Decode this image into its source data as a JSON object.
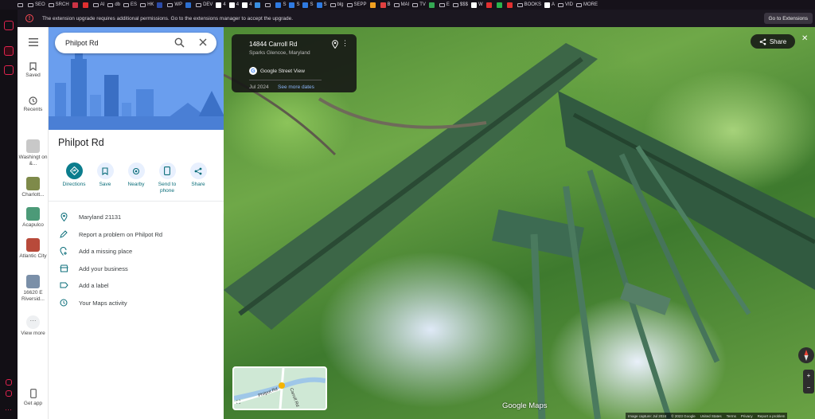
{
  "browser": {
    "bookmarks": [
      {
        "label": "",
        "kind": "folder"
      },
      {
        "label": "SEO",
        "kind": "folder"
      },
      {
        "label": "SRCH",
        "kind": "folder"
      },
      {
        "label": "",
        "kind": "sq",
        "color": "#cc3344"
      },
      {
        "label": "",
        "kind": "sq",
        "color": "#e03030"
      },
      {
        "label": "AI",
        "kind": "folder"
      },
      {
        "label": "db",
        "kind": "folder"
      },
      {
        "label": "ES",
        "kind": "folder"
      },
      {
        "label": "HK",
        "kind": "folder"
      },
      {
        "label": "",
        "kind": "sq",
        "color": "#2b4ba8"
      },
      {
        "label": "WP",
        "kind": "folder"
      },
      {
        "label": "",
        "kind": "sq",
        "color": "#2d6fd0"
      },
      {
        "label": "DEV",
        "kind": "folder"
      },
      {
        "label": "4",
        "kind": "sq",
        "color": "#ffffff"
      },
      {
        "label": "4",
        "kind": "sq",
        "color": "#ffffff"
      },
      {
        "label": "4",
        "kind": "sq",
        "color": "#ffffff"
      },
      {
        "label": "",
        "kind": "sq",
        "color": "#3a8fe0"
      },
      {
        "label": "",
        "kind": "folder"
      },
      {
        "label": "S",
        "kind": "sq",
        "color": "#2f7ae0"
      },
      {
        "label": "S",
        "kind": "sq",
        "color": "#2f7ae0"
      },
      {
        "label": "S",
        "kind": "sq",
        "color": "#2f7ae0"
      },
      {
        "label": "S",
        "kind": "sq",
        "color": "#2f7ae0"
      },
      {
        "label": "blg",
        "kind": "folder"
      },
      {
        "label": "SEPP",
        "kind": "folder"
      },
      {
        "label": "",
        "kind": "sq",
        "color": "#f0a020"
      },
      {
        "label": "B",
        "kind": "sq",
        "color": "#e04040"
      },
      {
        "label": "MAI",
        "kind": "folder"
      },
      {
        "label": "TV",
        "kind": "folder"
      },
      {
        "label": "",
        "kind": "sq",
        "color": "#34a853"
      },
      {
        "label": "E",
        "kind": "folder"
      },
      {
        "label": "$$$",
        "kind": "folder"
      },
      {
        "label": "W",
        "kind": "sq",
        "color": "#ffffff"
      },
      {
        "label": "",
        "kind": "sq",
        "color": "#e03030"
      },
      {
        "label": "",
        "kind": "sq",
        "color": "#2bb24c"
      },
      {
        "label": "",
        "kind": "sq",
        "color": "#e03030"
      },
      {
        "label": "BOOKS",
        "kind": "folder"
      },
      {
        "label": "A",
        "kind": "sq",
        "color": "#ffffff"
      },
      {
        "label": "VID",
        "kind": "folder"
      },
      {
        "label": "MORE",
        "kind": "folder"
      }
    ],
    "notice": {
      "message": "The extension upgrade requires additional permissions. Go to the extensions manager to accept the upgrade.",
      "button": "Go to Extensions"
    }
  },
  "nav": {
    "saved": "Saved",
    "recents": "Recents",
    "recent_items": [
      {
        "label": "Washingt on &...",
        "color": "#c8c8c8"
      },
      {
        "label": "Charlott...",
        "color": "#7e8a4a"
      },
      {
        "label": "Acapulco",
        "color": "#4c9a78"
      },
      {
        "label": "Atlantic City",
        "color": "#b84a3a"
      },
      {
        "label": "16620 E Riversid...",
        "color": "#7a8fa8"
      }
    ],
    "view_more": "View more",
    "get_app": "Get app"
  },
  "search": {
    "value": "Philpot Rd"
  },
  "place": {
    "title": "Philpot Rd",
    "actions": [
      "Directions",
      "Save",
      "Nearby",
      "Send to phone",
      "Share"
    ],
    "details": [
      "Maryland 21131",
      "Report a problem on Philpot Rd",
      "Add a missing place",
      "Add your business",
      "Add a label",
      "Your Maps activity"
    ]
  },
  "streetview": {
    "address": "14844 Carroll Rd",
    "locality": "Sparks Glencoe, Maryland",
    "source": "Google Street View",
    "date": "Jul 2024",
    "see_more": "See more dates",
    "share": "Share",
    "logo": "Google Maps",
    "minimap_roads": [
      "Philpot Rd",
      "Carroll Rd"
    ],
    "attribution": [
      "Image capture: Jul 2024",
      "© 2023 Google",
      "United States",
      "Terms",
      "Privacy",
      "Report a problem"
    ]
  },
  "colors": {
    "accent": "#1a73e8",
    "teal": "#0b7d8d",
    "hero": "#6a9eee",
    "brand_red": "#e0234e"
  }
}
